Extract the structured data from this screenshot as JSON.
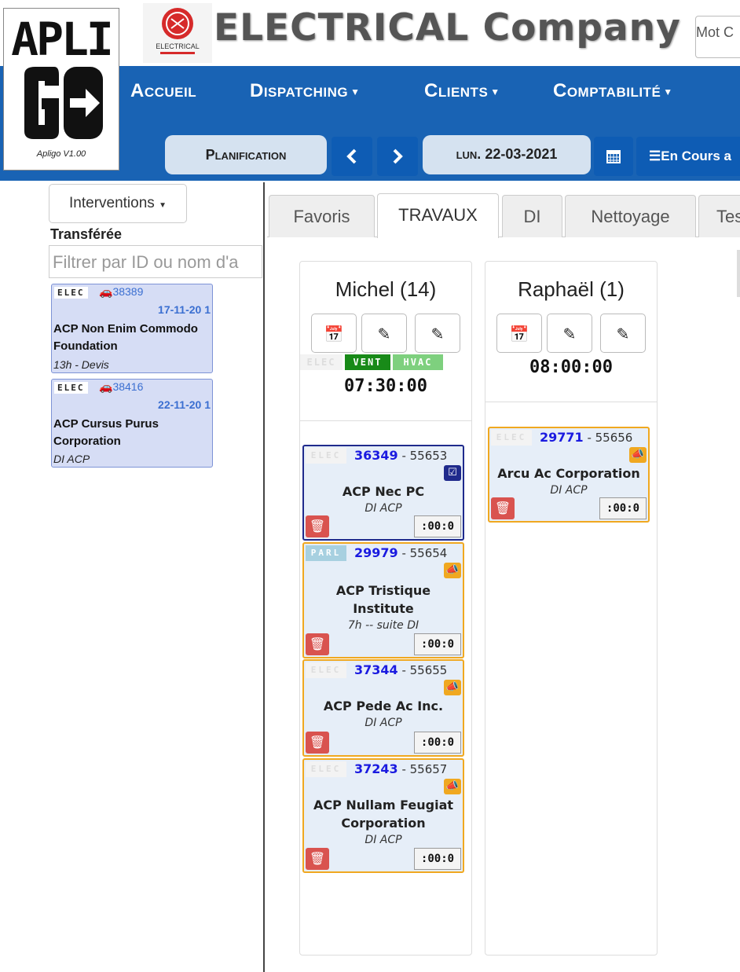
{
  "branding": {
    "logo_top": "APLI",
    "logo_version": "Apligo V1.00",
    "company_logo_text": "ELECTRICAL",
    "company_title": "ELECTRICAL Company"
  },
  "search": {
    "placeholder": "Mot C"
  },
  "nav": {
    "items": [
      {
        "label": "Accueil",
        "dropdown": false
      },
      {
        "label": "Dispatching",
        "dropdown": true
      },
      {
        "label": "Clients",
        "dropdown": true
      },
      {
        "label": "Comptabilité",
        "dropdown": true
      }
    ]
  },
  "toolbar": {
    "planification_label": "Planification",
    "date_label": "lun. 22-03-2021",
    "en_cours_label": "En Cours a"
  },
  "sidebar": {
    "dropdown_label": "Interventions",
    "section_title": "Transférée",
    "filter_placeholder": "Filtrer par ID ou nom d'a",
    "cards": [
      {
        "tag": "ELEC",
        "id": "38389",
        "date": "17-11-20 1",
        "name": "ACP Non Enim Commodo Foundation",
        "note": "13h - Devis"
      },
      {
        "tag": "ELEC",
        "id": "38416",
        "date": "22-11-20 1",
        "name": "ACP Cursus Purus Corporation",
        "note": "DI ACP"
      }
    ]
  },
  "tabs": [
    {
      "label": "Favoris",
      "active": false
    },
    {
      "label": "TRAVAUX",
      "active": true
    },
    {
      "label": "DI",
      "active": false
    },
    {
      "label": "Nettoyage",
      "active": false
    },
    {
      "label": "Tes",
      "active": false
    }
  ],
  "columns": [
    {
      "name": "Michel (14)",
      "time": "07:30:00",
      "skills": [
        "ELEC",
        "VENT",
        "HVAC"
      ],
      "cards": [
        {
          "tag": "ELEC",
          "id": "36349",
          "ref": "55653",
          "name": "ACP Nec PC",
          "note": "DI ACP",
          "time": ":00:0",
          "status": "checked"
        },
        {
          "tag": "PARL",
          "id": "29979",
          "ref": "55654",
          "name": "ACP Tristique Institute",
          "note": "7h -- suite DI",
          "time": ":00:0",
          "status": "announce"
        },
        {
          "tag": "ELEC",
          "id": "37344",
          "ref": "55655",
          "name": "ACP Pede Ac Inc.",
          "note": "DI ACP",
          "time": ":00:0",
          "status": "announce"
        },
        {
          "tag": "ELEC",
          "id": "37243",
          "ref": "55657",
          "name": "ACP Nullam Feugiat Corporation",
          "note": "DI ACP",
          "time": ":00:0",
          "status": "announce"
        }
      ]
    },
    {
      "name": "Raphaël (1)",
      "time": "08:00:00",
      "skills": [],
      "cards": [
        {
          "tag": "ELEC",
          "id": "29771",
          "ref": "55656",
          "name": "Arcu Ac Corporation",
          "note": "DI ACP",
          "time": ":00:0",
          "status": "announce"
        }
      ]
    }
  ],
  "colors": {
    "nav_blue": "#1963b4",
    "button_blue": "#0e5cb4",
    "pill_bg": "#d5e2f0",
    "card_border_orange": "#f0a820",
    "card_border_navy": "#1f2a8c",
    "delete_red": "#d9534f",
    "skill_vent": "#188a18",
    "skill_hvac": "#7ed07e"
  },
  "icons": {
    "calendar": "calendar-icon",
    "edit": "edit-icon",
    "prev": "chevron-left-icon",
    "next": "chevron-right-icon",
    "delete": "trash-icon",
    "announce": "bullhorn-icon",
    "checked": "check-square-icon",
    "car": "car-icon"
  }
}
